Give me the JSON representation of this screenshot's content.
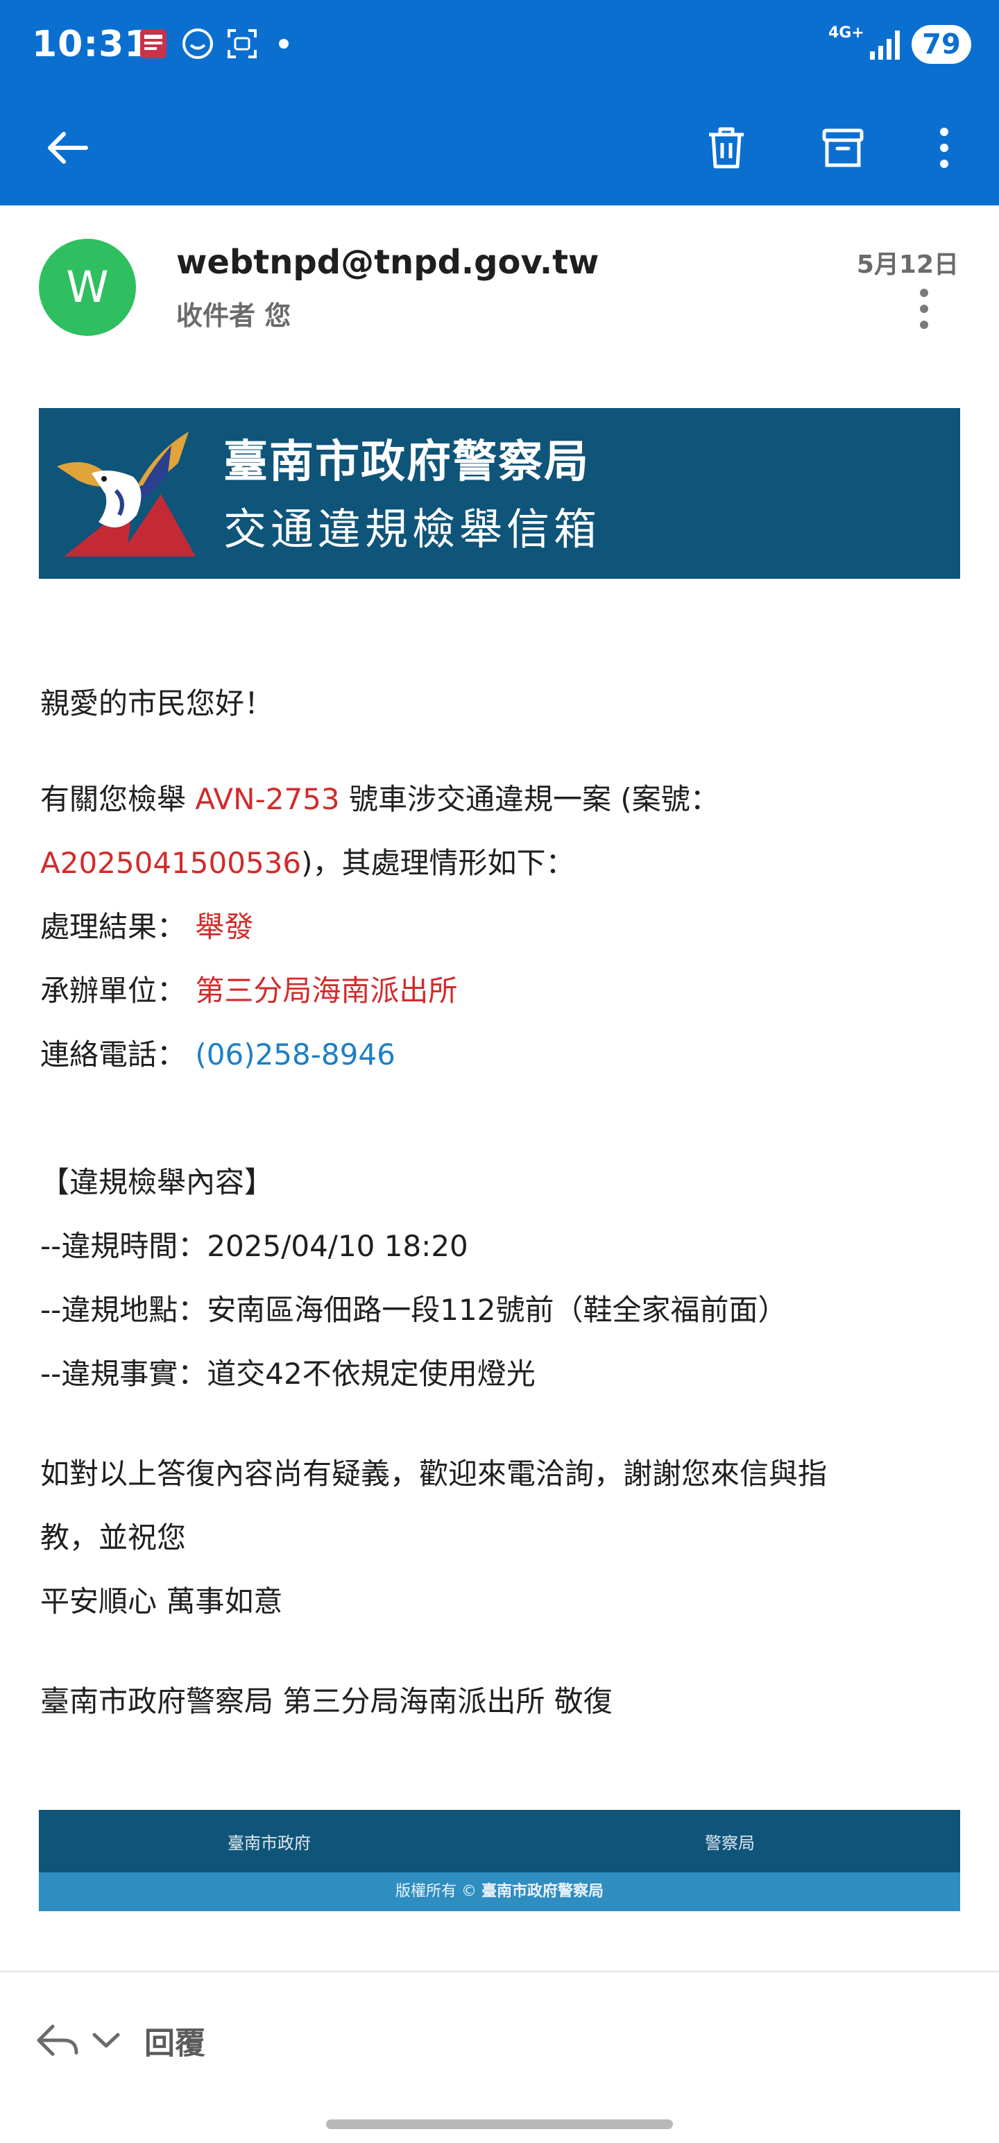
{
  "status_bar": {
    "time": "10:31",
    "network": "4G+",
    "battery": "79"
  },
  "toolbar": {
    "back_icon": "arrow-left-icon",
    "delete_icon": "trash-icon",
    "archive_icon": "archive-icon",
    "more_icon": "more-vertical-icon"
  },
  "header": {
    "avatar_letter": "W",
    "avatar_color": "#2fbf60",
    "sender": "webtnpd@tnpd.gov.tw",
    "recipient": "收件者 您",
    "date": "5月12日"
  },
  "banner": {
    "title": "臺南市政府警察局",
    "subtitle": "交通違規檢舉信箱"
  },
  "body": {
    "greeting": "親愛的市民您好！",
    "p1_prefix": "有關您檢舉",
    "plate": "AVN-2753",
    "p1_mid": "號車涉交通違規一案 (案號：",
    "case_no": "A2025041500536",
    "p1_suffix": ")，其處理情形如下：",
    "result_label": "處理結果：",
    "result_value": "舉發",
    "unit_label": "承辦單位：",
    "unit_value": "第三分局海南派出所",
    "phone_label": "連絡電話：",
    "phone_value": "(06)258-8946",
    "content_heading": "【違規檢舉內容】",
    "time_line": "--違規時間：2025/04/10 18:20",
    "place_line": "--違規地點：安南區海佃路一段112號前（鞋全家福前面）",
    "fact_line": "--違規事實：道交42不依規定使用燈光",
    "closing_1": "如對以上答復內容尚有疑義，歡迎來電洽詢，謝謝您來信與指",
    "closing_2": "教，並祝您",
    "closing_3": "平安順心 萬事如意",
    "signature": "臺南市政府警察局 第三分局海南派出所 敬復"
  },
  "footer": {
    "link_city": "臺南市政府",
    "link_police": "警察局",
    "copyright_prefix": "版權所有 ©",
    "copyright_owner": "臺南市政府警察局"
  },
  "reply": {
    "label": "回覆"
  },
  "colors": {
    "appbar": "#0b6fd0",
    "banner": "#0f5479",
    "footer_bottom": "#2f8dc0",
    "highlight_red": "#d12b2b",
    "link_blue": "#1d7fc4"
  }
}
